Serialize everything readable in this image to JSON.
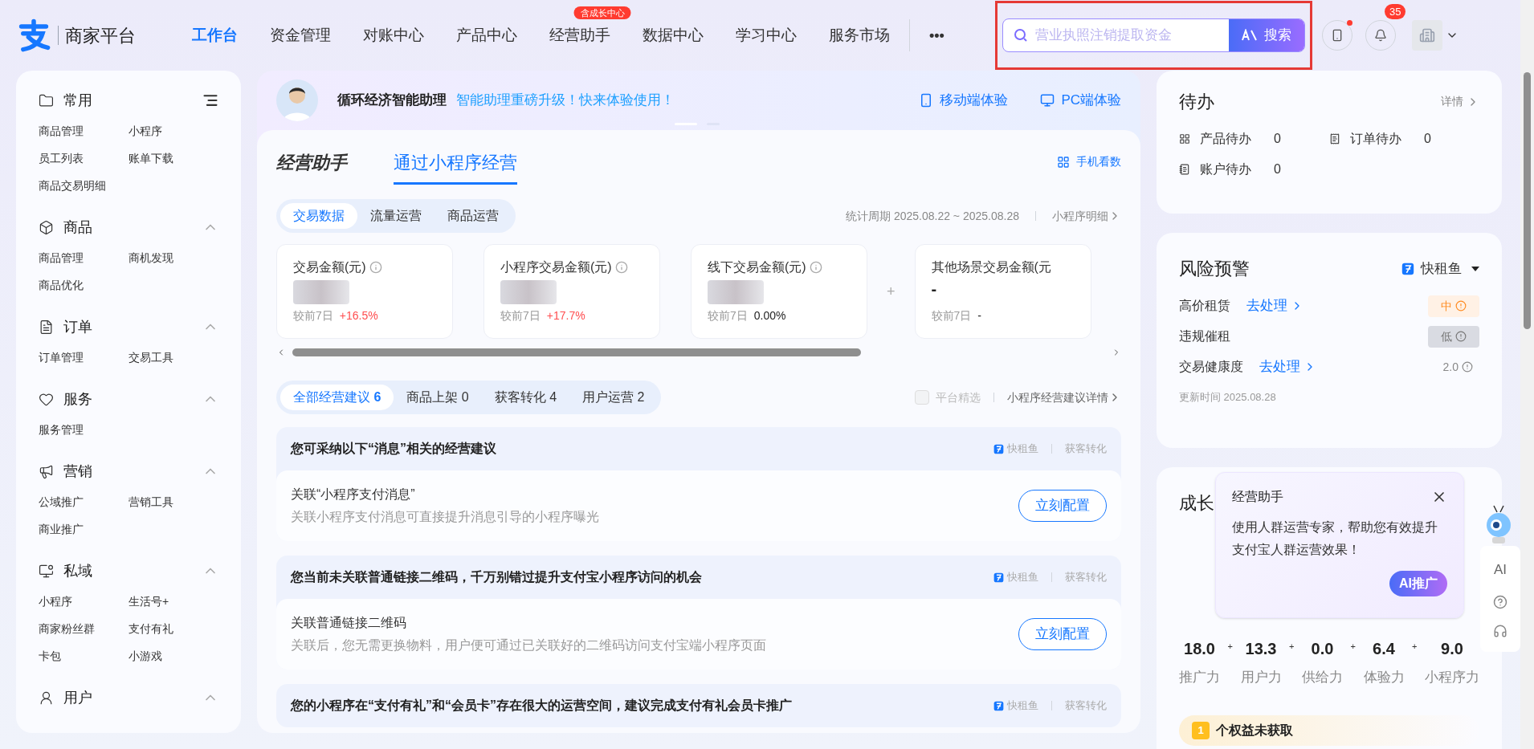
{
  "header": {
    "logo_text": "商家平台",
    "nav": [
      {
        "label": "工作台",
        "selected": true
      },
      {
        "label": "资金管理",
        "selected": false
      },
      {
        "label": "对账中心",
        "selected": false
      },
      {
        "label": "产品中心",
        "selected": false
      },
      {
        "label": "经营助手",
        "selected": false,
        "badge": "含成长中心"
      },
      {
        "label": "数据中心",
        "selected": false
      },
      {
        "label": "学习中心",
        "selected": false
      },
      {
        "label": "服务市场",
        "selected": false
      }
    ],
    "more": "•••",
    "search": {
      "placeholder": "营业执照注销提取资金",
      "button": "搜索",
      "highlighted": true
    },
    "phone_dot": true,
    "notifications": "35"
  },
  "sidebar": [
    {
      "title": "常用",
      "items": [
        "商品管理",
        "小程序",
        "员工列表",
        "账单下载",
        "商品交易明细"
      ]
    },
    {
      "title": "商品",
      "expanded": true,
      "items": [
        "商品管理",
        "商机发现",
        "商品优化"
      ]
    },
    {
      "title": "订单",
      "expanded": true,
      "items": [
        "订单管理",
        "交易工具"
      ]
    },
    {
      "title": "服务",
      "expanded": true,
      "items": [
        "服务管理"
      ]
    },
    {
      "title": "营销",
      "expanded": true,
      "items": [
        "公域推广",
        "营销工具",
        "商业推广"
      ]
    },
    {
      "title": "私域",
      "expanded": true,
      "items": [
        "小程序",
        "生活号+",
        "商家粉丝群",
        "支付有礼",
        "卡包",
        "小游戏"
      ]
    },
    {
      "title": "用户",
      "expanded": true
    }
  ],
  "banner": {
    "name": "循环经济智能助理",
    "slogan": "智能助理重磅升级！快来体验使用！",
    "links": [
      {
        "kind": "mobile",
        "label": "移动端体验"
      },
      {
        "kind": "pc",
        "label": "PC端体验"
      }
    ],
    "dots": [
      {
        "selected": true
      },
      {
        "selected": false
      }
    ]
  },
  "main": {
    "tabs": [
      {
        "label": "经营助手",
        "selected": false
      },
      {
        "label": "通过小程序经营",
        "selected": true
      }
    ],
    "phone_view": "手机看数",
    "data_tabs": [
      {
        "label": "交易数据",
        "selected": true
      },
      {
        "label": "流量运营",
        "selected": false
      },
      {
        "label": "商品运营",
        "selected": false
      }
    ],
    "period": "统计周期 2025.08.22 ~ 2025.08.28",
    "detail_link": "小程序明细",
    "metrics": [
      {
        "title": "交易金额(元)",
        "info": true,
        "blurred": true,
        "compare": "较前7日",
        "change": "+16.5%",
        "color": "#ff4d4f"
      },
      {
        "title": "小程序交易金额(元)",
        "info": true,
        "blurred": true,
        "compare": "较前7日",
        "change": "+17.7%",
        "color": "#ff4d4f"
      },
      {
        "title": "线下交易金额(元)",
        "info": true,
        "blurred": true,
        "compare": "较前7日",
        "change": "0.00%",
        "color": "#222222"
      },
      {
        "title": "其他场景交易金额(元",
        "info": false,
        "blurred": false,
        "value": "-",
        "compare": "较前7日",
        "change": "-",
        "color": "#222222"
      }
    ],
    "plus": "+",
    "suggestion_tabs": [
      {
        "label": "全部经营建议",
        "count": "6",
        "selected": true
      },
      {
        "label": "商品上架",
        "count": "0",
        "selected": false
      },
      {
        "label": "获客转化",
        "count": "4",
        "selected": false
      },
      {
        "label": "用户运营",
        "count": "2",
        "selected": false
      }
    ],
    "platform_pick": {
      "label": "平台精选",
      "checked": false
    },
    "suggestion_link": "小程序经营建议详情",
    "suggestions": [
      {
        "title": "您可采纳以下“消息”相关的经营建议",
        "app": "快租鱼",
        "category": "获客转化",
        "item": "关联“小程序支付消息”",
        "desc": "关联小程序支付消息可直接提升消息引导的小程序曝光",
        "action": "立刻配置"
      },
      {
        "title": "您当前未关联普通链接二维码，千万别错过提升支付宝小程序访问的机会",
        "app": "快租鱼",
        "category": "获客转化",
        "item": "关联普通链接二维码",
        "desc": "关联后，您无需更换物料，用户便可通过已关联好的二维码访问支付宝端小程序页面",
        "action": "立刻配置"
      },
      {
        "title": "您的小程序在“支付有礼”和“会员卡”存在很大的运营空间，建议完成支付有礼会员卡推广",
        "app": "快租鱼",
        "category": "获客转化"
      }
    ]
  },
  "todo": {
    "title": "待办",
    "detail": "详情",
    "items": [
      {
        "label": "产品待办",
        "count": "0"
      },
      {
        "label": "订单待办",
        "count": "0"
      },
      {
        "label": "账户待办",
        "count": "0"
      }
    ]
  },
  "risk": {
    "title": "风险预警",
    "app": "快租鱼",
    "rows": [
      {
        "label": "高价租赁",
        "action": "去处理",
        "kind": "medium",
        "level": "中"
      },
      {
        "label": "违规催租",
        "kind": "low",
        "level": "低"
      },
      {
        "label": "交易健康度",
        "action": "去处理",
        "kind": "plain",
        "level": "2.0"
      }
    ],
    "updated": "更新时间 2025.08.28"
  },
  "growth": {
    "title": "成长",
    "scores": [
      {
        "value": "18.0",
        "label": "推广力"
      },
      {
        "value": "13.3",
        "label": "用户力"
      },
      {
        "value": "0.0",
        "label": "供给力"
      },
      {
        "value": "6.4",
        "label": "体验力"
      },
      {
        "value": "9.0",
        "label": "小程序力"
      }
    ],
    "plus": "+",
    "rights_count": "1",
    "rights_text": "个权益未获取"
  },
  "popup": {
    "title": "经营助手",
    "body": "使用人群运营专家，帮助您有效提升支付宝人群运营效果！",
    "button": "AI推广"
  },
  "float_bar": {
    "ai": "AI"
  }
}
